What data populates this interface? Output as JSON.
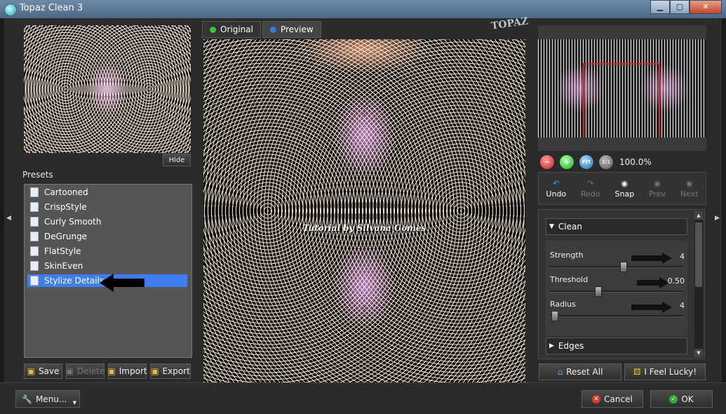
{
  "window": {
    "title": "Topaz Clean 3",
    "minimize": "▁",
    "maximize": "▢",
    "close": "✕"
  },
  "left": {
    "hide_label": "Hide",
    "presets_label": "Presets",
    "presets": [
      "Cartooned",
      "CrispStyle",
      "Curly Smooth",
      "DeGrunge",
      "FlatStyle",
      "SkinEven",
      "Stylize Details"
    ],
    "selected_index": 6,
    "buttons": {
      "save": "Save",
      "delete": "Delete",
      "import": "Import",
      "export": "Export"
    }
  },
  "center": {
    "tabs": [
      {
        "label": "Original",
        "color": "#3ac23a"
      },
      {
        "label": "Preview",
        "color": "#3a7ae0"
      }
    ],
    "active_tab": 1,
    "watermark": "Tutorial by Silvana Gomes",
    "logo": "TOPAZ"
  },
  "right": {
    "zoom": "100.0%",
    "history": [
      {
        "label": "Undo",
        "enabled": true
      },
      {
        "label": "Redo",
        "enabled": false
      },
      {
        "label": "Snap",
        "enabled": true
      },
      {
        "label": "Prev",
        "enabled": false
      },
      {
        "label": "Next",
        "enabled": false
      }
    ],
    "sections": {
      "clean": {
        "title": "Clean",
        "params": [
          {
            "name": "Strength",
            "value": "4",
            "fraction": 0.55
          },
          {
            "name": "Threshold",
            "value": "0.50",
            "fraction": 0.36
          },
          {
            "name": "Radius",
            "value": "4",
            "fraction": 0.02
          }
        ]
      },
      "edges": {
        "title": "Edges"
      }
    },
    "reset_all": "Reset All",
    "feel_lucky": "I Feel Lucky!"
  },
  "bottom": {
    "menu": "Menu...",
    "cancel": "Cancel",
    "ok": "OK"
  },
  "colors": {
    "selection": "#3f7ef0",
    "accent_red": "#e02020"
  }
}
